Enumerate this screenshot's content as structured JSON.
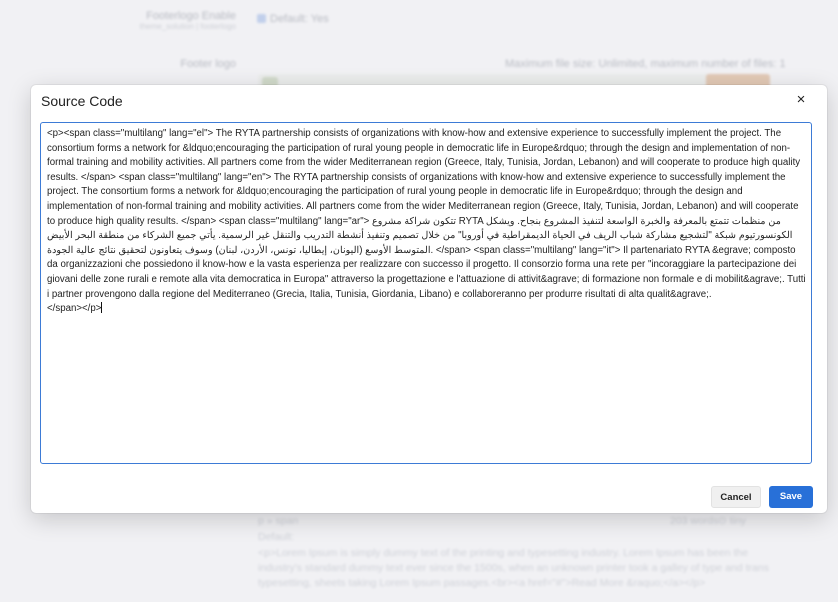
{
  "background": {
    "footerlogo_enable_label": "Footerlogo Enable",
    "footerlogo_enable_sub": "theme_solution | footerlogo",
    "footerlogo_enable_value": "Default: Yes",
    "footer_logo_label": "Footer logo",
    "footer_logo_hint": "Maximum file size: Unlimited, maximum number of files: 1",
    "editor_status_path": "p » span",
    "editor_word_count": "203 words",
    "editor_brand": "tiny",
    "default_label": "Default:",
    "default_text": "<p>Lorem Ipsum is simply dummy text of the printing and typesetting industry. Lorem Ipsum has been the industry's standard dummy text ever since the 1500s, when an unknown printer took a galley of type and trans typesetting, sheets taking Lorem Ipsum passages.<br><a href=\"#\">Read More &raquo;</a></p>"
  },
  "modal": {
    "title": "Source Code",
    "close_glyph": "×",
    "source_code": "<p><span class=\"multilang\" lang=\"el\"> The RYTA partnership consists of organizations with know-how and extensive experience to successfully implement the project. The consortium forms a network for &ldquo;encouraging the participation of rural young people in democratic life in Europe&rdquo; through the design and implementation of non-formal training and mobility activities. All partners come from the wider Mediterranean region (Greece, Italy, Tunisia, Jordan, Lebanon) and will cooperate to produce high quality results. </span> <span class=\"multilang\" lang=\"en\"> The RYTA partnership consists of organizations with know-how and extensive experience to successfully implement the project. The consortium forms a network for &ldquo;encouraging the participation of rural young people in democratic life in Europe&rdquo; through the design and implementation of non-formal training and mobility activities. All partners come from the wider Mediterranean region (Greece, Italy, Tunisia, Jordan, Lebanon) and will cooperate to produce high quality results. </span> <span class=\"multilang\" lang=\"ar\"> تتكون شراكة مشروع RYTA من منظمات تتمتع بالمعرفة والخبرة الواسعة لتنفيذ المشروع بنجاح. ويشكل الكونسورتيوم شبكة \"لتشجيع مشاركة شباب الريف في الحياة الديمقراطية في أوروبا\" من خلال تصميم وتنفيذ أنشطة التدريب والتنقل غير الرسمية. يأتي جميع الشركاء من منطقة البحر الأبيض المتوسط الأوسع (اليونان، إيطاليا، تونس، الأردن، لبنان) وسوف يتعاونون لتحقيق نتائج عالية الجودة. </span> <span class=\"multilang\" lang=\"it\"> Il partenariato RYTA &egrave; composto da organizzazioni che possiedono il know-how e la vasta esperienza per realizzare con successo il progetto. Il consorzio forma una rete per \"incoraggiare la partecipazione dei giovani delle zone rurali e remote alla vita democratica in Europa\" attraverso la progettazione e l'attuazione di attivit&agrave; di formazione non formale e di mobilit&agrave;. Tutti i partner provengono dalla regione del Mediterraneo (Grecia, Italia, Tunisia, Giordania, Libano) e collaboreranno per produrre risultati di alta qualit&agrave;.\n</span></p>",
    "cancel_label": "Cancel",
    "save_label": "Save"
  },
  "colors": {
    "primary": "#2870d8",
    "focus_border": "#3d7bd6"
  }
}
